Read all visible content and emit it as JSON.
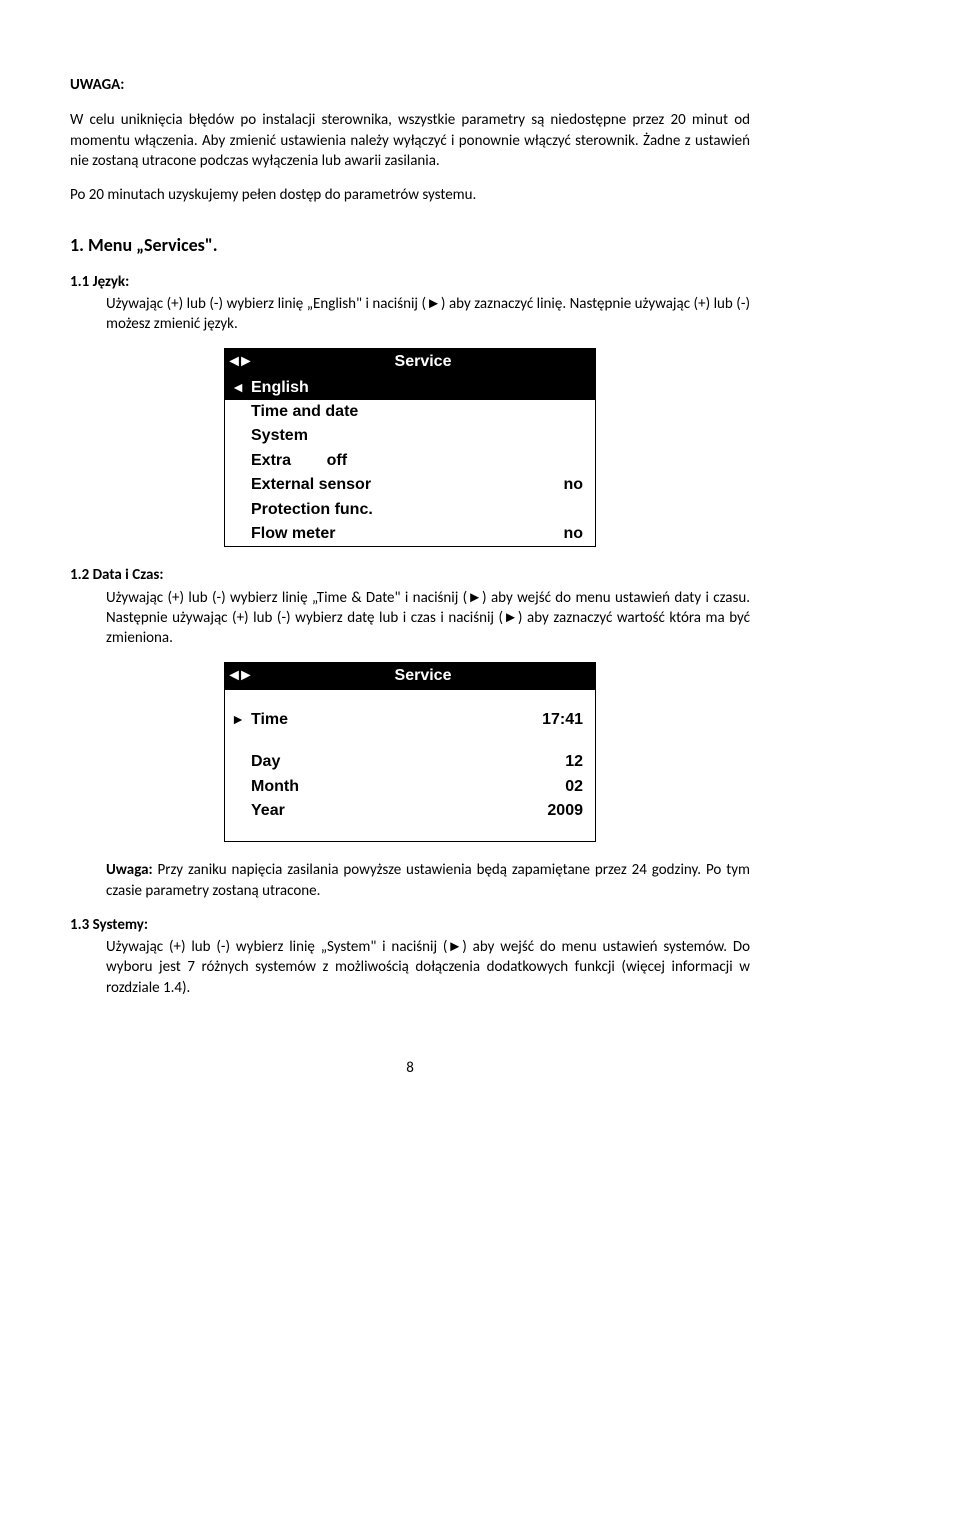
{
  "heading": "UWAGA:",
  "p1": "W celu uniknięcia błędów po instalacji sterownika, wszystkie parametry są niedostępne przez 20 minut od momentu włączenia. Aby zmienić ustawienia należy wyłączyć i ponownie włączyć sterownik. Żadne z ustawień nie zostaną utracone podczas wyłączenia lub awarii zasilania.",
  "p2": "Po 20 minutach uzyskujemy pełen dostęp do parametrów systemu.",
  "menu_heading": "1. Menu „Services\".",
  "s11_heading": "1.1 Język:",
  "s11_text": "Używając (+) lub (-) wybierz linię „English\" i naciśnij (►) aby zaznaczyć linię. Następnie używając (+) lub (-) możesz zmienić język.",
  "s12_heading": "1.2 Data i Czas:",
  "s12_text": "Używając (+) lub (-) wybierz linię „Time & Date\" i naciśnij (►) aby wejść do menu ustawień daty i czasu. Następnie używając (+) lub (-) wybierz datę lub i czas i naciśnij (►) aby zaznaczyć wartość która ma być zmieniona.",
  "note_label": "Uwaga:",
  "note_text": " Przy zaniku napięcia zasilania powyższe ustawienia będą zapamiętane przez 24 godziny. Po tym czasie parametry zostaną utracone.",
  "s13_heading": "1.3 Systemy:",
  "s13_text": "Używając (+) lub (-) wybierz linię „System\" i naciśnij (►) aby wejść do menu ustawień systemów. Do wyboru jest 7 różnych systemów z możliwością dołączenia dodatkowych funkcji (więcej informacji w rozdziale 1.4).",
  "screen1": {
    "title": "Service",
    "head_arrows": "◄►",
    "rows": [
      {
        "arrow": "◄",
        "label": "English",
        "val": "",
        "sel": true
      },
      {
        "arrow": "",
        "label": "Time and date",
        "val": "",
        "sel": false
      },
      {
        "arrow": "",
        "label": "System",
        "val": "",
        "sel": false
      },
      {
        "arrow": "",
        "label": "Extra",
        "val": "off",
        "sel": false,
        "inline": true
      },
      {
        "arrow": "",
        "label": "External sensor",
        "val": "no",
        "sel": false
      },
      {
        "arrow": "",
        "label": "Protection func.",
        "val": "",
        "sel": false
      },
      {
        "arrow": "",
        "label": "Flow meter",
        "val": "no",
        "sel": false
      }
    ]
  },
  "screen2": {
    "title": "Service",
    "head_arrows": "◄►",
    "rows": [
      {
        "arrow": "►",
        "label": "Time",
        "val": "17:41"
      },
      {
        "arrow": "",
        "label": "Day",
        "val": "12"
      },
      {
        "arrow": "",
        "label": "Month",
        "val": "02"
      },
      {
        "arrow": "",
        "label": "Year",
        "val": "2009"
      }
    ]
  },
  "page_number": "8"
}
